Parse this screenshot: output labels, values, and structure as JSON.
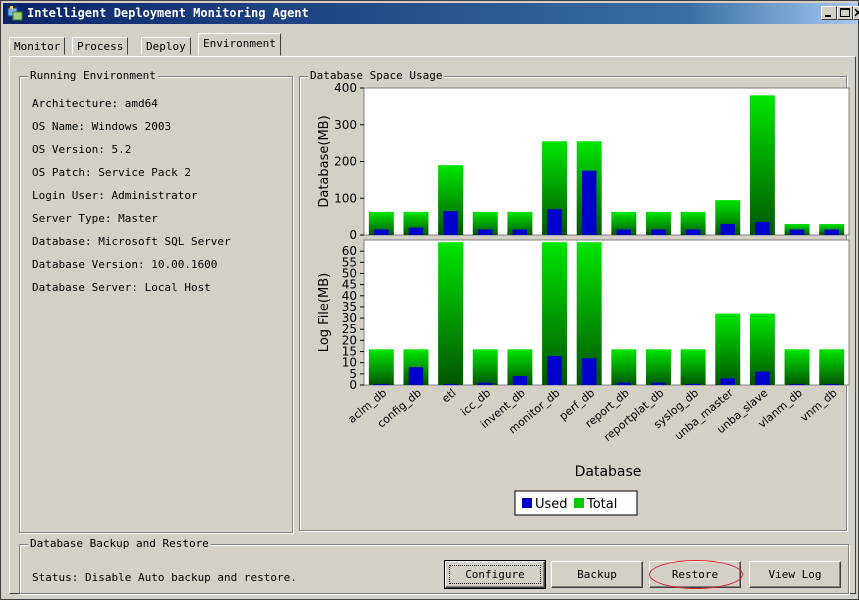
{
  "window": {
    "title": "Intelligent Deployment Monitoring Agent"
  },
  "tabs": [
    {
      "label": "Monitor"
    },
    {
      "label": "Process"
    },
    {
      "label": "Deploy"
    },
    {
      "label": "Environment",
      "active": true
    }
  ],
  "environment": {
    "group_title": "Running Environment",
    "lines": [
      "Architecture: amd64",
      "OS Name: Windows 2003",
      "OS Version: 5.2",
      "OS Patch: Service Pack 2",
      "Login User: Administrator",
      "Server Type: Master",
      "Database: Microsoft SQL Server",
      "Database Version: 10.00.1600",
      "Database Server: Local Host"
    ]
  },
  "db_usage": {
    "group_title": "Database Space Usage"
  },
  "backup": {
    "group_title": "Database Backup and Restore",
    "status": "Status: Disable Auto backup and restore.",
    "configure_label": "Configure",
    "backup_label": "Backup",
    "restore_label": "Restore",
    "view_log_label": "View Log"
  },
  "chart_data": {
    "type": "bar",
    "categories": [
      "aclm_db",
      "config_db",
      "etl",
      "icc_db",
      "invent_db",
      "monitor_db",
      "perf_db",
      "report_db",
      "reportplat_db",
      "syslog_db",
      "unba_master",
      "unba_slave",
      "vlanm_db",
      "vnm_db"
    ],
    "xlabel": "Database",
    "legend": [
      "Used",
      "Total"
    ],
    "colors": {
      "used": "#0000cc",
      "total_top": "#00e600",
      "total_bottom": "#005500"
    },
    "panels": [
      {
        "ylabel": "Database(MB)",
        "ylim": [
          0,
          400
        ],
        "yticks": [
          0,
          100,
          200,
          300,
          400
        ],
        "used": [
          15,
          20,
          65,
          15,
          15,
          70,
          175,
          15,
          15,
          15,
          30,
          35,
          15,
          15
        ],
        "total": [
          63,
          63,
          190,
          63,
          63,
          255,
          255,
          63,
          63,
          63,
          95,
          380,
          30,
          30
        ]
      },
      {
        "ylabel": "Log File(MB)",
        "ylim": [
          0,
          65
        ],
        "yticks": [
          0,
          5,
          10,
          15,
          20,
          25,
          30,
          35,
          40,
          45,
          50,
          55,
          60
        ],
        "used": [
          0.5,
          8,
          0.5,
          1,
          4,
          13,
          12,
          1,
          1,
          0.5,
          3,
          6,
          0.5,
          0.5
        ],
        "total": [
          16,
          16,
          64,
          16,
          16,
          64,
          64,
          16,
          16,
          16,
          32,
          32,
          16,
          16
        ]
      }
    ]
  }
}
